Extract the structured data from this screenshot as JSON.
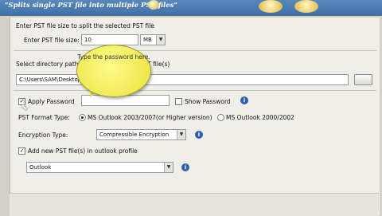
{
  "header": {
    "title": "\"Splits single PST file into multiple PST files\""
  },
  "split_size": {
    "section_label": "Enter PST file size to split the selected PST file",
    "field_label": "Enter PST file size:",
    "value": "10",
    "unit": "MB"
  },
  "directory": {
    "section_label": "Select directory path to save the splitted PST file(s)",
    "path": "C:\\Users\\SAM\\Desktop"
  },
  "password": {
    "apply_label": "Apply Password",
    "show_label": "Show Password"
  },
  "format": {
    "label": "PST Format Type:",
    "option1": "MS Outlook 2003/2007(or Higher version)",
    "option2": "MS Outlook 2000/2002",
    "selected": "option1"
  },
  "encryption": {
    "label": "Encryption Type:",
    "value": "Compressible Encryption"
  },
  "profile": {
    "checkbox_label": "Add new PST file(s) in outlook profile",
    "value": "Outlook"
  },
  "tooltip": {
    "text": "Type the password here."
  },
  "icons": {
    "info": "info-icon",
    "checkbox_checked": "check-icon"
  }
}
